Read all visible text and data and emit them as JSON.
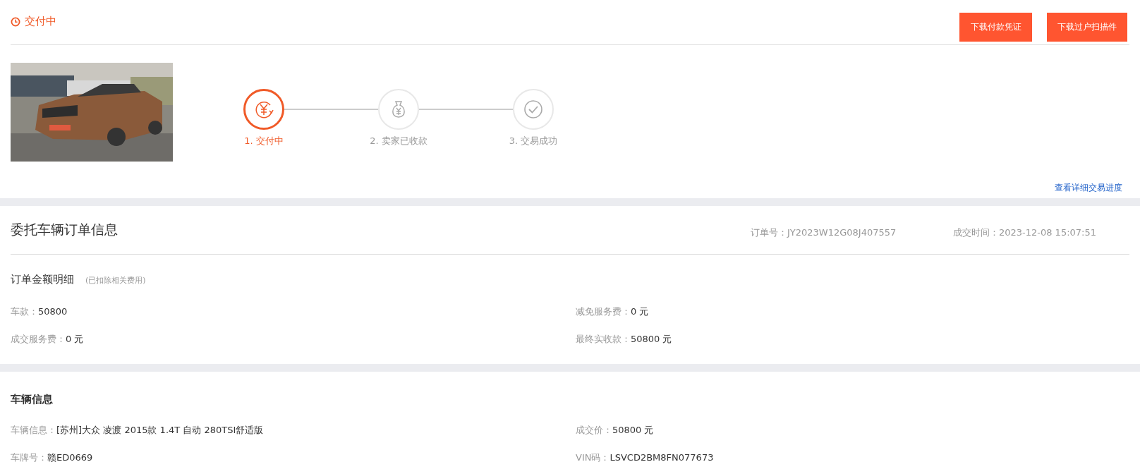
{
  "status": {
    "text": "交付中"
  },
  "buttons": [
    "下载付款凭证",
    "下载过户扫描件"
  ],
  "car_photo": {
    "kind": "picture"
  },
  "steps": [
    {
      "label": "1. 交付中",
      "kind": "payment",
      "active": true
    },
    {
      "label": "2. 卖家已收款",
      "kind": "received",
      "active": false
    },
    {
      "label": "3. 交易成功",
      "kind": "done",
      "active": false
    }
  ],
  "progress_link": "查看详细交易进度",
  "order": {
    "title": "委托车辆订单信息",
    "meta": [
      {
        "label": "订单号：",
        "value": "JY2023W12G08J407557"
      },
      {
        "label": "成交时间：",
        "value": "2023-12-08 15:07:51"
      }
    ],
    "subtitle": "订单金额明细",
    "note": "(已扣除相关费用)",
    "fields": [
      {
        "label": "车款：",
        "value": "50800"
      },
      {
        "label": "减免服务费：",
        "value": "0 元"
      },
      {
        "label": "成交服务费：",
        "value": "0 元"
      },
      {
        "label": "最终实收款：",
        "value": "50800 元"
      }
    ]
  },
  "vehicle": {
    "title": "车辆信息",
    "fields": [
      {
        "label": "车辆信息：",
        "value": "[苏州]大众 凌渡 2015款 1.4T 自动 280TSI舒适版"
      },
      {
        "label": "成交价：",
        "value": "50800 元"
      },
      {
        "label": "车牌号：",
        "value": "赣ED0669"
      },
      {
        "label": "VIN码：",
        "value": "LSVCD2BM8FN077673"
      }
    ]
  }
}
